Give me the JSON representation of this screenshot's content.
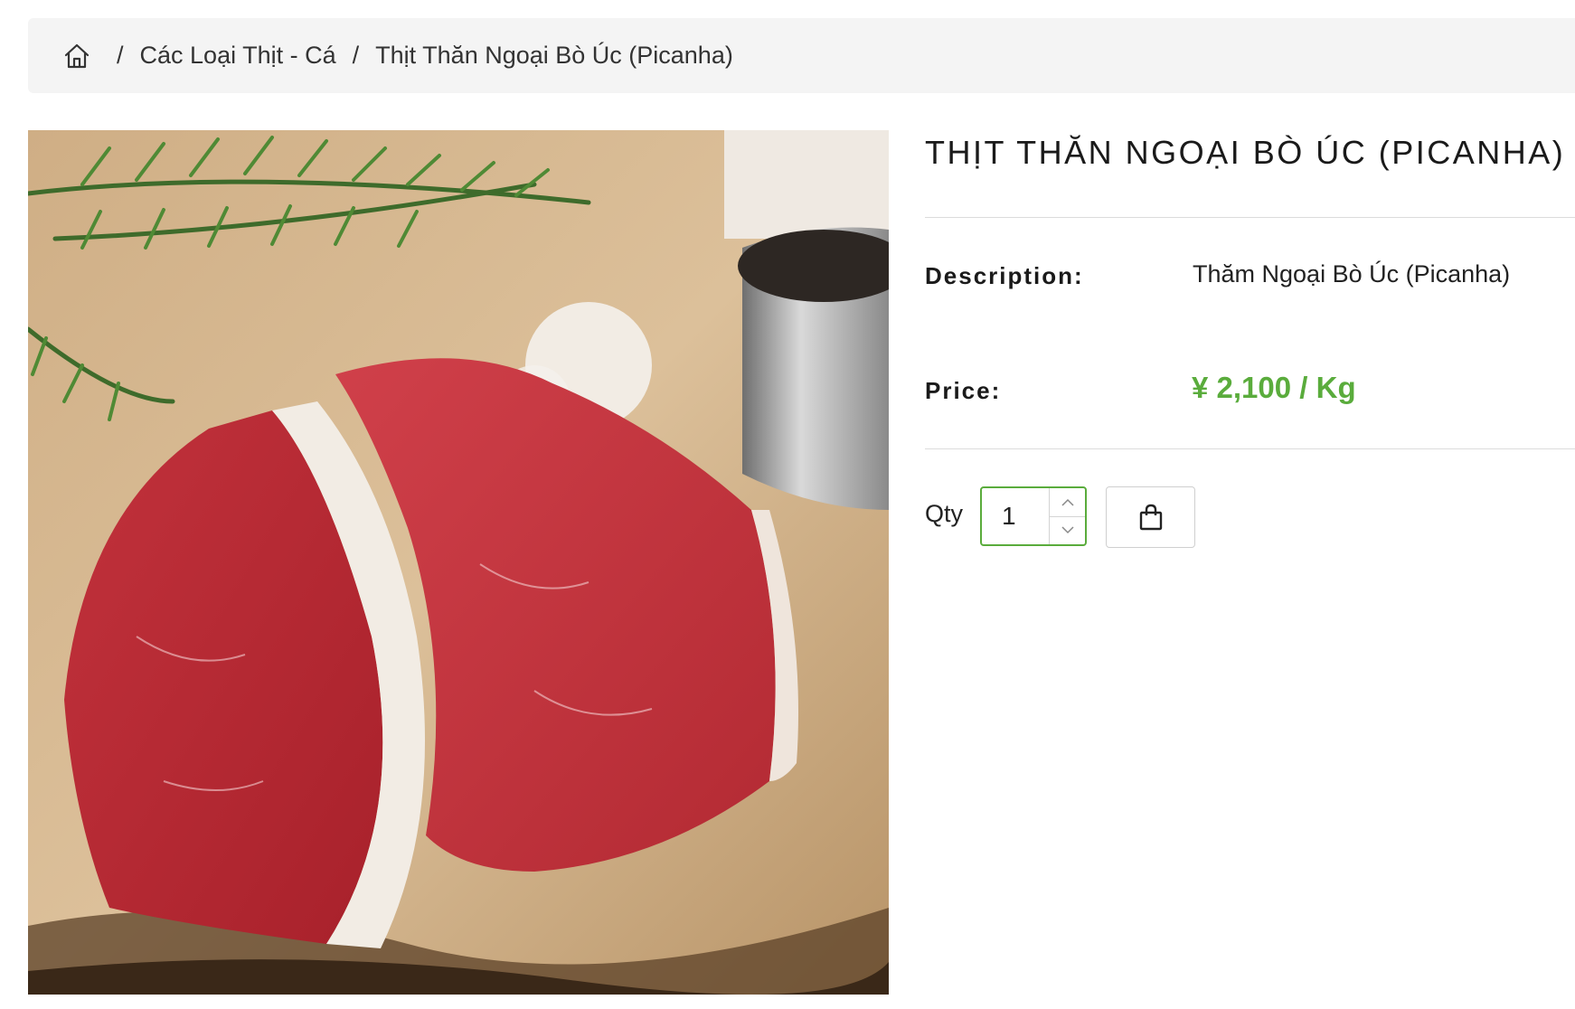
{
  "breadcrumb": {
    "home_icon": "home-icon",
    "separator": "/",
    "category": "Các Loại Thịt - Cá",
    "current": "Thịt Thăn Ngoại Bò Úc (Picanha)"
  },
  "product": {
    "title": "THỊT THĂN NGOẠI BÒ ÚC (PICANHA)",
    "description_label": "Description:",
    "description": "Thăm Ngoại Bò Úc (Picanha)",
    "price_label": "Price:",
    "price": "¥ 2,100 / Kg",
    "image_alt": "Raw beef steaks on a wooden board with rosemary, salt and peppercorns"
  },
  "purchase": {
    "qty_label": "Qty",
    "qty_value": "1",
    "increment_icon": "chevron-up-icon",
    "decrement_icon": "chevron-down-icon",
    "cart_icon": "shopping-bag-icon"
  },
  "colors": {
    "accent": "#5aac3c",
    "breadcrumb_bg": "#f4f4f4"
  }
}
